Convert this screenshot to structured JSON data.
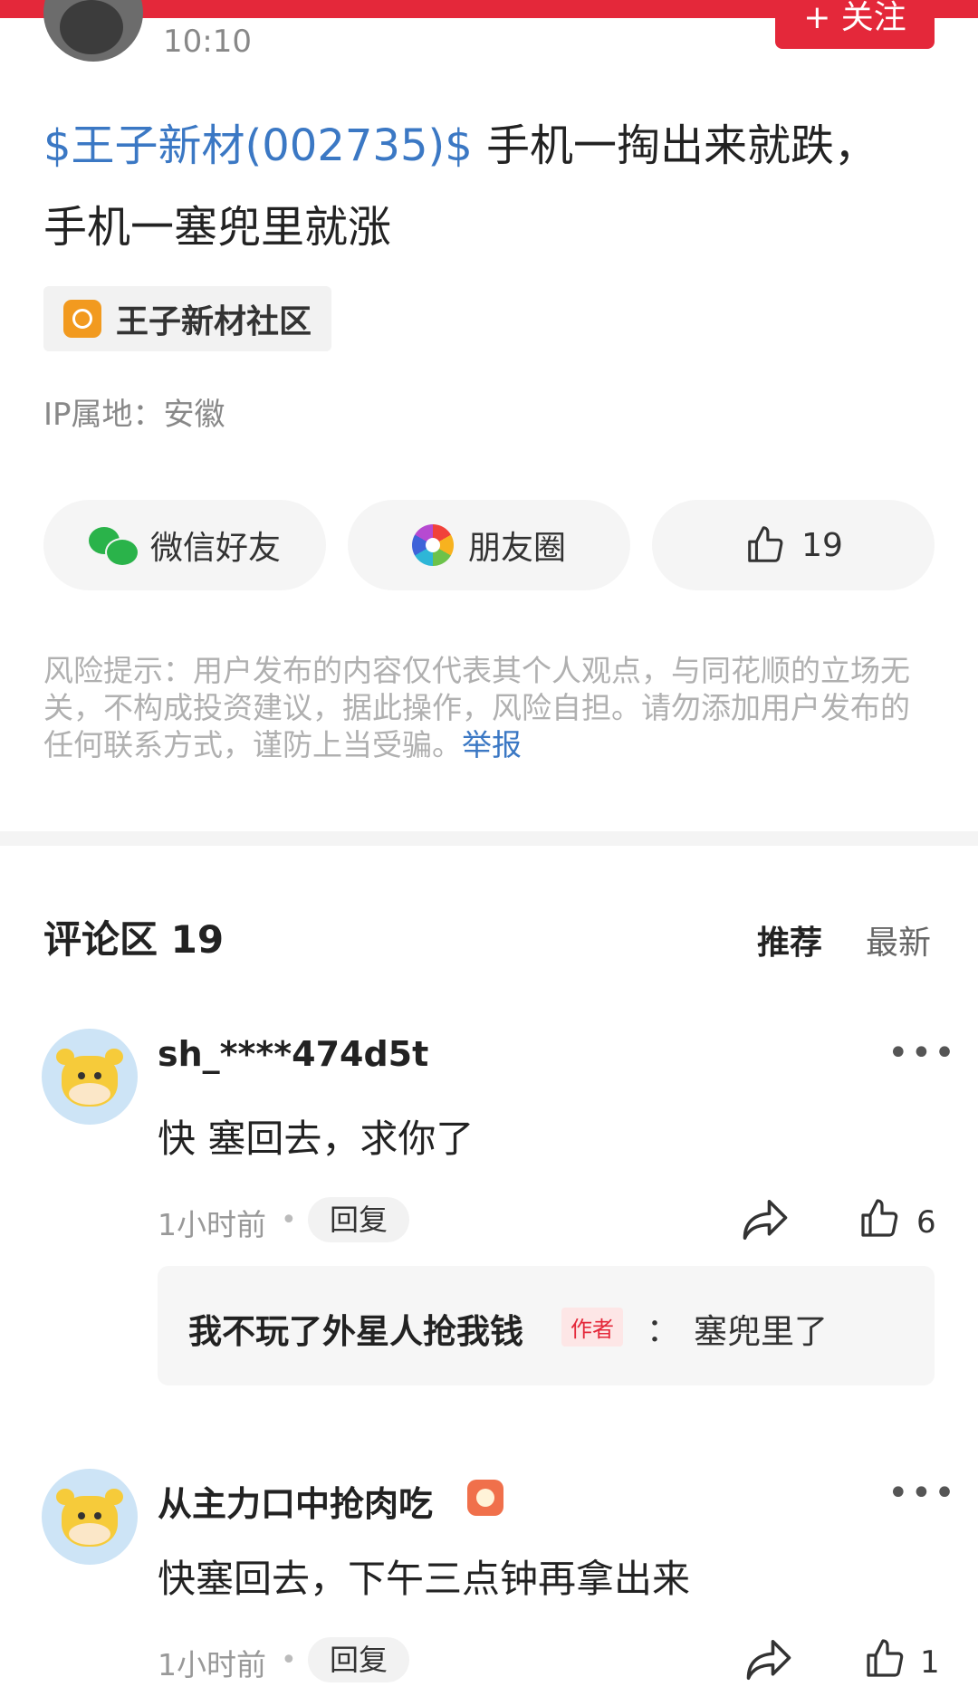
{
  "post": {
    "time": "10:10",
    "follow_label": "+ 关注",
    "stock_tag": "$王子新材(002735)$",
    "text_line1": " 手机一掏出来就跌，",
    "text_line2": "手机一塞兜里就涨",
    "community": "王子新材社区",
    "ip": "IP属地：安徽"
  },
  "share": {
    "wechat_label": "微信好友",
    "moments_label": "朋友圈",
    "like_count": "19"
  },
  "risk": {
    "text": "风险提示：用户发布的内容仅代表其个人观点，与同花顺的立场无关，不构成投资建议，据此操作，风险自担。请勿添加用户发布的任何联系方式，谨防上当受骗。",
    "report_label": "举报"
  },
  "comments_section": {
    "title": "评论区 19",
    "sort_recommend": "推荐",
    "sort_latest": "最新"
  },
  "comments": [
    {
      "user": "sh_****474d5t",
      "text": "快 塞回去，求你了",
      "time": "1小时前",
      "reply_label": "回复",
      "like_count": "6",
      "sub_reply": {
        "user": "我不玩了外星人抢我钱",
        "tag": "作者",
        "colon": "：",
        "text": "塞兜里了"
      }
    },
    {
      "user": "从主力口中抢肉吃",
      "text": "快塞回去，下午三点钟再拿出来",
      "time": "1小时前",
      "reply_label": "回复",
      "like_count": "1"
    }
  ],
  "colors": {
    "brand_red": "#e4283a",
    "link_blue": "#3b78c4",
    "community_orange": "#f29a1f",
    "wechat_green": "#2ab34a"
  },
  "icons": {
    "more": "more-dots-icon",
    "share": "share-arrow-icon",
    "like": "thumbs-up-icon"
  }
}
